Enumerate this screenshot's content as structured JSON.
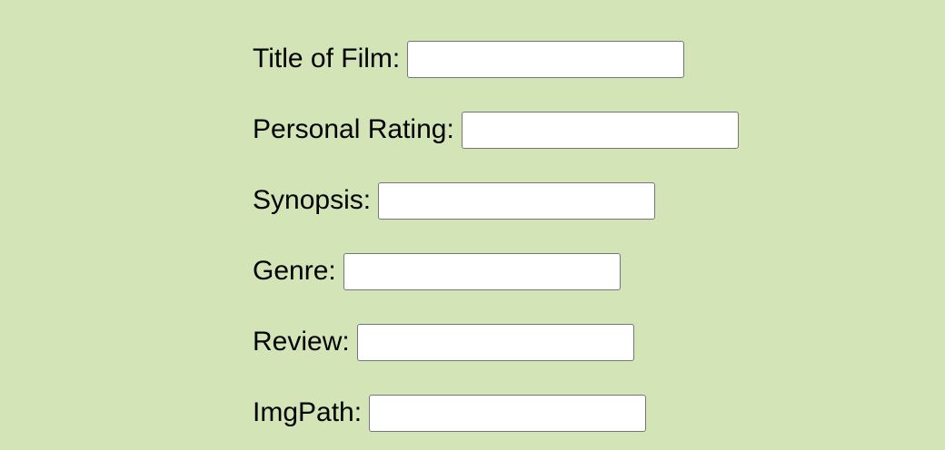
{
  "form": {
    "fields": [
      {
        "label": "Title of Film:",
        "value": "",
        "placeholder": ""
      },
      {
        "label": "Personal Rating:",
        "value": "",
        "placeholder": ""
      },
      {
        "label": "Synopsis:",
        "value": "",
        "placeholder": ""
      },
      {
        "label": "Genre:",
        "value": "",
        "placeholder": ""
      },
      {
        "label": "Review:",
        "value": "",
        "placeholder": ""
      },
      {
        "label": "ImgPath:",
        "value": "",
        "placeholder": ""
      }
    ]
  },
  "colors": {
    "background": "#d3e5b7",
    "input_border": "#767676",
    "input_background": "#ffffff",
    "text": "#000000"
  }
}
